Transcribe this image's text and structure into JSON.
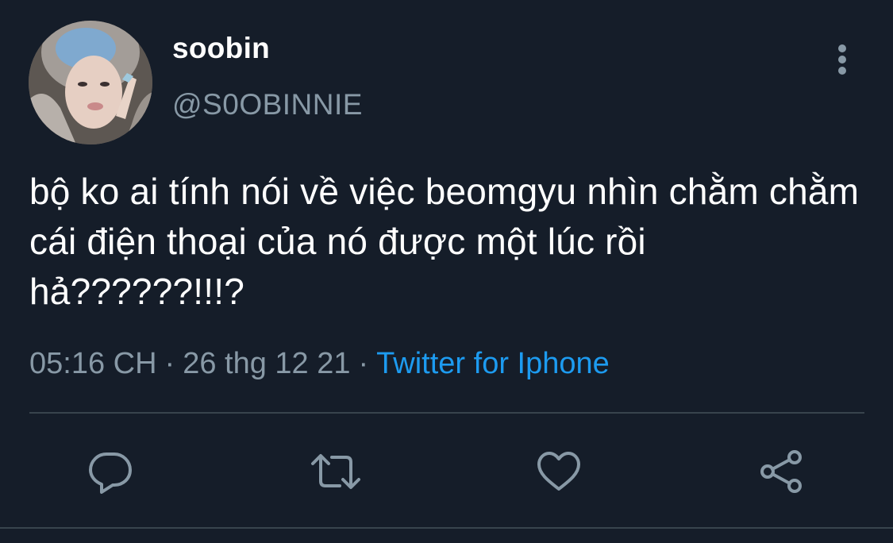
{
  "tweet": {
    "display_name": "soobin",
    "handle": "@S0OBINNIE",
    "text": "bộ ko ai tính nói về việc beomgyu nhìn chằm chằm cái điện thoại của nó được một lúc rồi hả??????!!!?",
    "time": "05:16 CH",
    "date": "26 thg 12 21",
    "separator_1": "·",
    "separator_2": "·",
    "source": "Twitter for Iphone"
  },
  "icons": {
    "more": "more-vertical-icon",
    "reply": "reply-icon",
    "retweet": "retweet-icon",
    "like": "heart-icon",
    "share": "share-icon"
  },
  "colors": {
    "background": "#151d29",
    "primary_text": "#ffffff",
    "secondary_text": "#8899a6",
    "link": "#1d9bf0",
    "divider": "#38444d"
  }
}
